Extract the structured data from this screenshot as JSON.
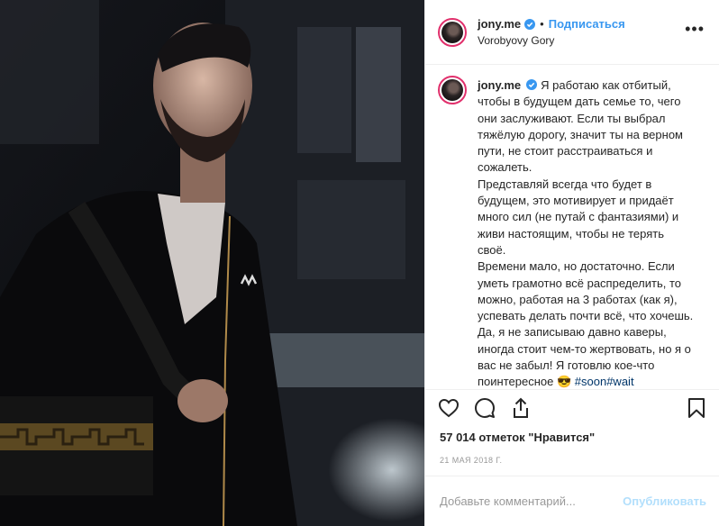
{
  "post": {
    "username": "jony.me",
    "separator": "•",
    "follow_label": "Подписаться",
    "location": "Vorobyovy Gory",
    "more_label": "•••",
    "caption": {
      "username": "jony.me",
      "paragraphs": [
        "Я работаю как отбитый, чтобы в будущем дать семье то, чего они заслуживают. Если ты выбрал тяжёлую дорогу, значит ты на верном пути, не стоит расстраиваться и сожалеть.",
        "Представляй всегда что будет в будущем, это мотивирует и придаёт много сил (не путай с фантазиями) и живи настоящим, чтобы не терять своё.",
        "Времени мало, но достаточно. Если уметь грамотно всё распределить, то можно, работая на 3 работах (как я), успевать делать почти всё, что хочешь.",
        "Да, я не записываю давно каверы, иногда стоит чем-то жертвовать, но я о вас не забыл! Я готовлю кое-что поинтересное 😎"
      ],
      "tags": "#soon#wait"
    },
    "likes_text": "57 014 отметок \"Нравится\"",
    "date": "21 МАЯ 2018 Г.",
    "comment_placeholder": "Добавьте комментарий...",
    "publish_label": "Опубликовать",
    "colors": {
      "accent": "#3897f0",
      "ring": "#e1306c",
      "publish_disabled": "#b2dffc"
    }
  }
}
